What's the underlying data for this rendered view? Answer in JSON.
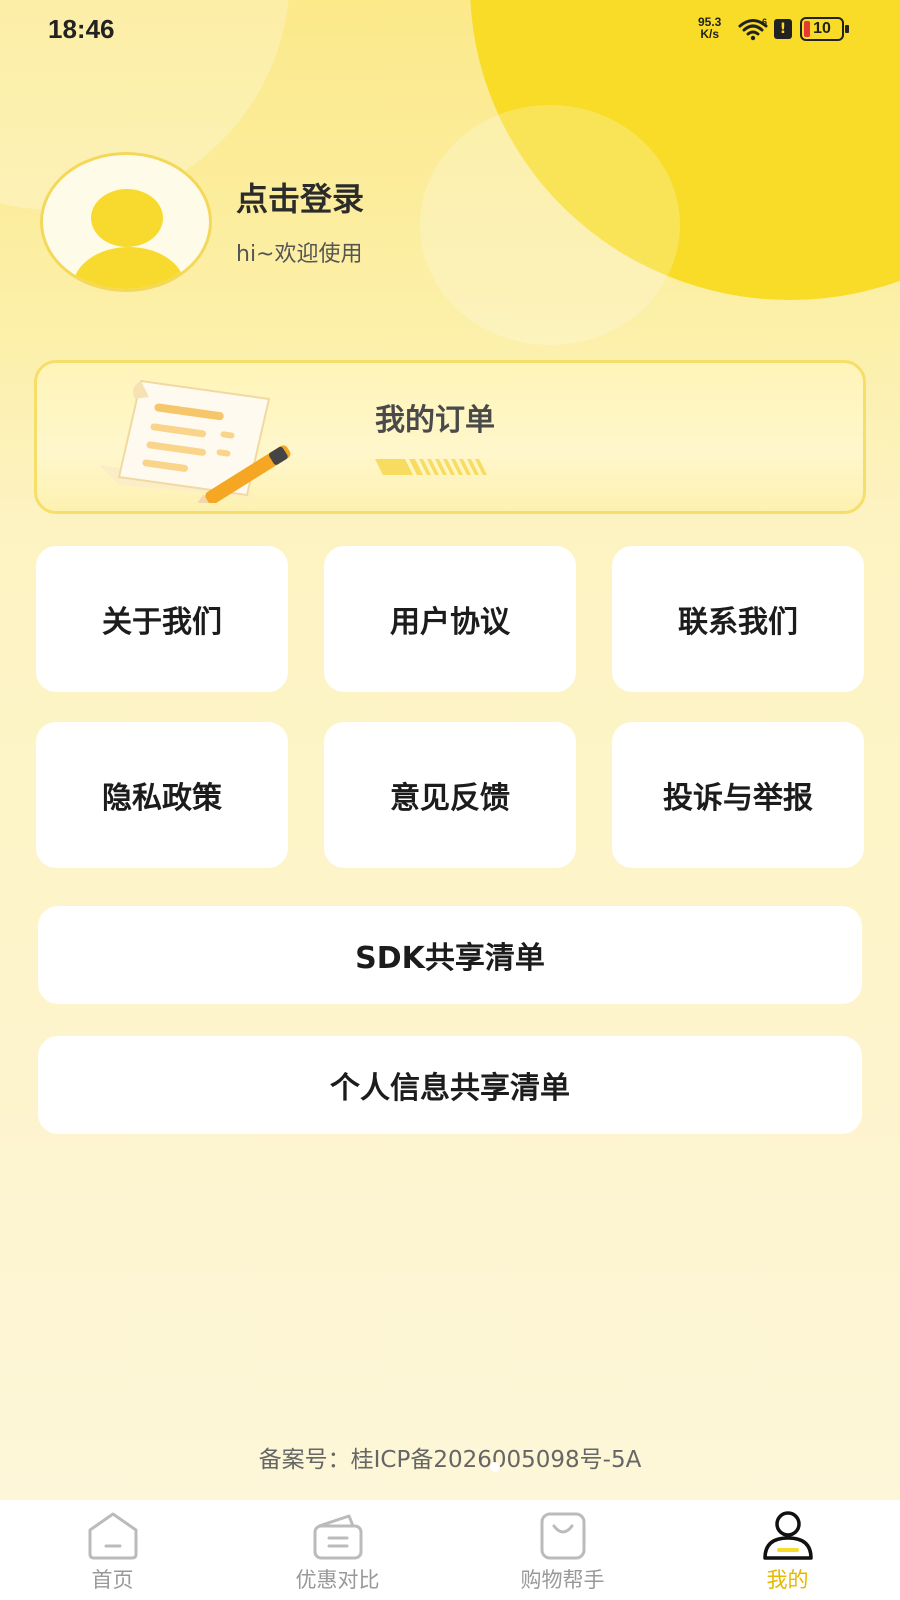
{
  "status_bar": {
    "time": "18:46",
    "net_speed_value": "95.3",
    "net_speed_unit": "K/s",
    "signal_label": "6",
    "alert_icon": "!",
    "battery": "10"
  },
  "profile": {
    "login_text": "点击登录",
    "greeting": "hi~欢迎使用"
  },
  "order_card": {
    "title": "我的订单"
  },
  "menu": {
    "row1": [
      "关于我们",
      "用户协议",
      "联系我们"
    ],
    "row2": [
      "隐私政策",
      "意见反馈",
      "投诉与举报"
    ]
  },
  "list_buttons": {
    "sdk": "SDK共享清单",
    "personal_info": "个人信息共享清单"
  },
  "footer": {
    "icp": "备案号：桂ICP备2026005098号-5A"
  },
  "tabbar": {
    "tabs": [
      {
        "label": "首页",
        "icon": "home-icon"
      },
      {
        "label": "优惠对比",
        "icon": "wallet-icon"
      },
      {
        "label": "购物帮手",
        "icon": "shopping-bag-icon"
      },
      {
        "label": "我的",
        "icon": "user-icon",
        "active": true
      }
    ],
    "active_color": "#e6b800",
    "inactive_color": "#999999"
  },
  "colors": {
    "accent": "#f8dc28",
    "background": "#fdf4cc"
  }
}
